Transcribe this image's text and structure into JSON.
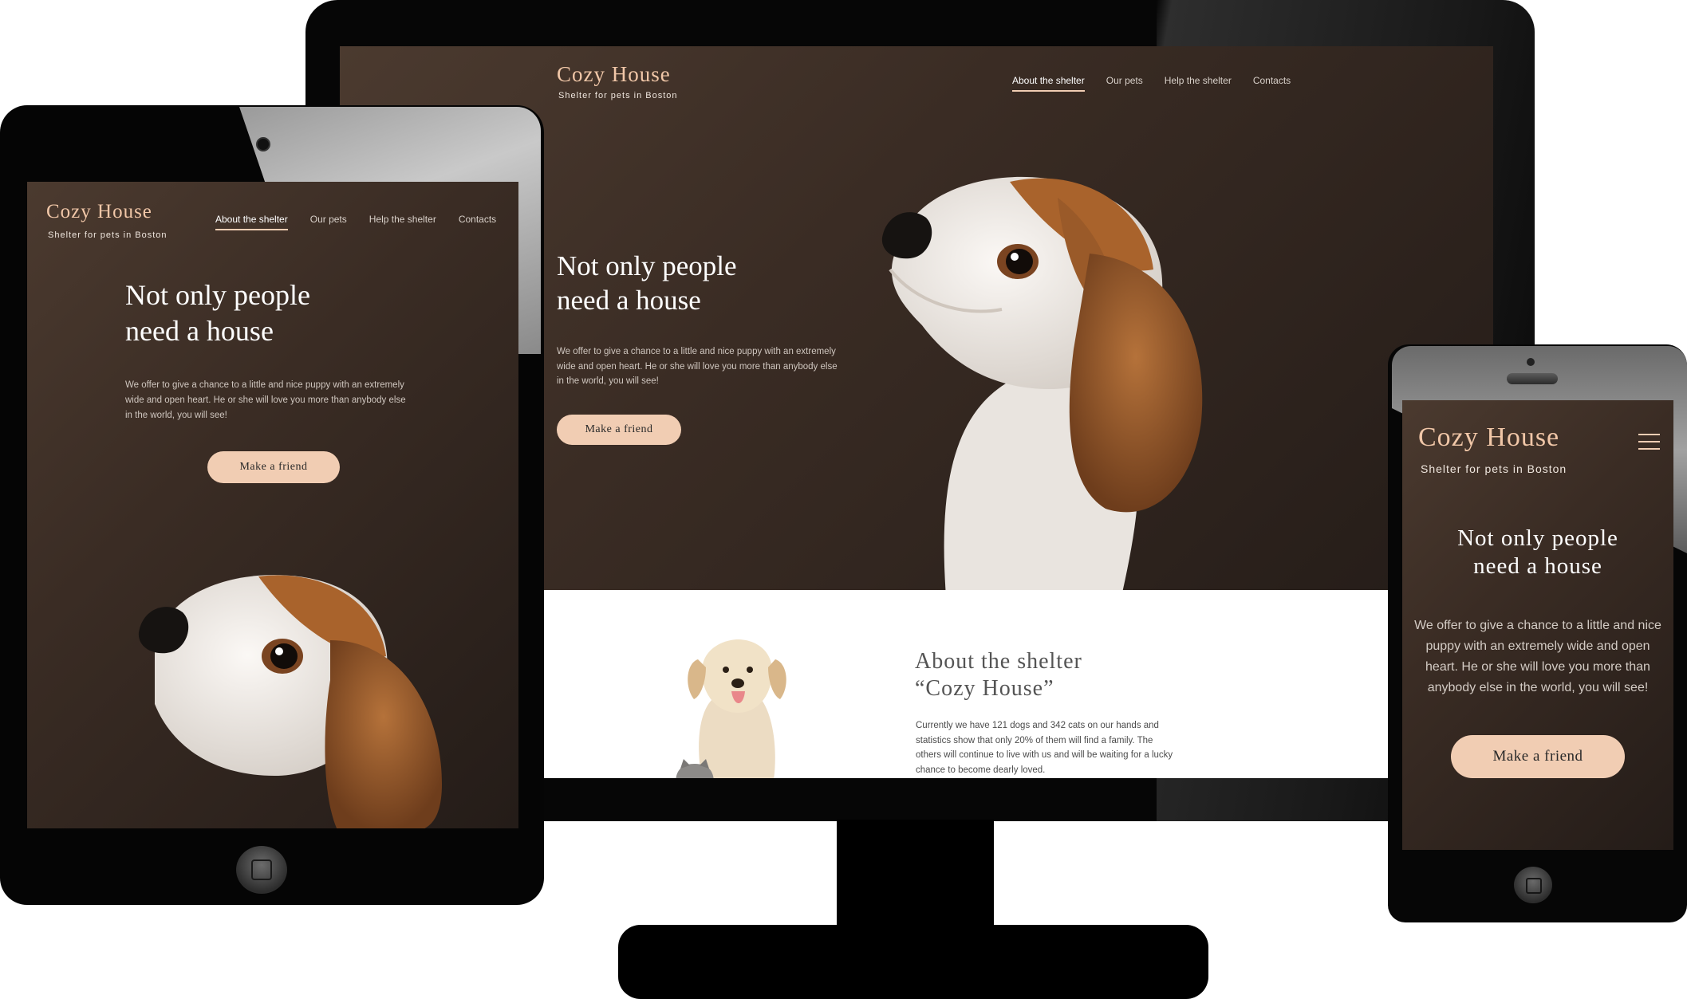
{
  "brand": {
    "logo": "Cozy House",
    "tagline": "Shelter for pets in Boston"
  },
  "nav": {
    "items": [
      "About the shelter",
      "Our pets",
      "Help the shelter",
      "Contacts"
    ],
    "active_index": 0
  },
  "hero": {
    "title_line1": "Not only people",
    "title_line2": "need a house",
    "text_desktop": [
      "We offer to give a chance to a little and nice puppy with an extremely",
      "wide and open heart. He or she will love you more than anybody else",
      "in the world, you will see!"
    ],
    "text_tablet": [
      "We offer to give a chance to a little and nice puppy with an extremely",
      "wide and open heart. He or she will love you more than anybody else",
      "in the world, you will see!"
    ],
    "text_mobile": [
      "We offer to give a chance to a little and nice",
      "puppy with an extremely wide and open",
      "heart. He or she will love you more than",
      "anybody else in the world, you will see!"
    ],
    "button_label": "Make a friend"
  },
  "about": {
    "title_line1": "About the shelter",
    "title_line2": "“Cozy House”",
    "text": [
      "Currently we have 121 dogs and 342 cats on our hands and",
      "statistics show that only 20% of them will find a family. The",
      "others will continue to live with us and will be waiting for a lucky",
      "chance to become dearly loved."
    ]
  },
  "icons": {
    "menu": "hamburger-menu-icon",
    "home_button": "home-button-icon"
  },
  "colors": {
    "accent": "#f1cdb3",
    "logo": "#f1c7a8",
    "hero_dark": "#2e241e",
    "white": "#ffffff"
  }
}
